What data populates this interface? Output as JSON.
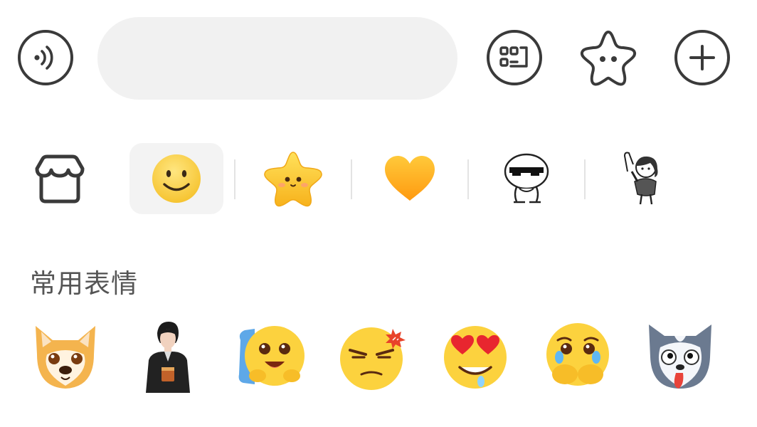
{
  "input": {
    "placeholder": ""
  },
  "toolbar": {
    "voice_icon": "voice-icon",
    "keyboard_icon": "keyboard-icon",
    "sticker_icon": "star-face-icon",
    "add_icon": "plus-icon"
  },
  "tabs": [
    {
      "icon": "shop-icon",
      "active": false
    },
    {
      "icon": "smiley-icon",
      "active": true
    },
    {
      "icon": "star-face-icon",
      "active": false
    },
    {
      "icon": "heart-icon",
      "active": false
    },
    {
      "icon": "sunglasses-meme-icon",
      "active": false
    },
    {
      "icon": "girl-sticker-icon",
      "active": false
    }
  ],
  "frequent": {
    "title": "常用表情",
    "items": [
      "shiba-dog-emoji",
      "man-sticker",
      "hug-blue-emoji",
      "annoyed-emoji",
      "heart-eyes-drool-emoji",
      "crying-cover-mouth-emoji",
      "husky-tongue-emoji"
    ]
  }
}
